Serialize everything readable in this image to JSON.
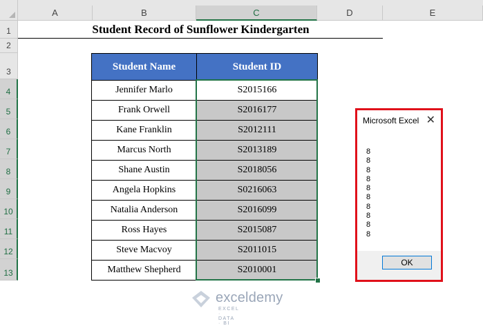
{
  "columns": [
    {
      "label": "A",
      "selected": false
    },
    {
      "label": "B",
      "selected": false
    },
    {
      "label": "C",
      "selected": true
    },
    {
      "label": "D",
      "selected": false
    },
    {
      "label": "E",
      "selected": false
    }
  ],
  "rows": [
    "1",
    "2",
    "3",
    "4",
    "5",
    "6",
    "7",
    "8",
    "9",
    "10",
    "11",
    "12",
    "13"
  ],
  "title": "Student Record of Sunflower Kindergarten",
  "table": {
    "headers": [
      "Student Name",
      "Student ID"
    ],
    "rows": [
      [
        "Jennifer Marlo",
        "S2015166"
      ],
      [
        "Frank Orwell",
        "S2016177"
      ],
      [
        "Kane Franklin",
        "S2012111"
      ],
      [
        "Marcus North",
        "S2013189"
      ],
      [
        "Shane Austin",
        "S2018056"
      ],
      [
        "Angela Hopkins",
        "S0216063"
      ],
      [
        "Natalia Anderson",
        "S2016099"
      ],
      [
        "Ross Hayes",
        "S2015087"
      ],
      [
        "Steve Macvoy",
        "S2011015"
      ],
      [
        "Matthew Shepherd",
        "S2010001"
      ]
    ]
  },
  "dialog": {
    "title": "Microsoft Excel",
    "message": "8\n8\n8\n8\n8\n8\n8\n8\n8\n8",
    "ok_label": "OK",
    "close_glyph": "✕"
  },
  "watermark": {
    "name": "exceldemy",
    "tagline": "EXCEL · DATA · BI"
  },
  "colors": {
    "header_fill": "#4472c4",
    "selected_fill": "#c8c8c8",
    "selection_border": "#217346",
    "dialog_highlight": "#e0101a"
  }
}
